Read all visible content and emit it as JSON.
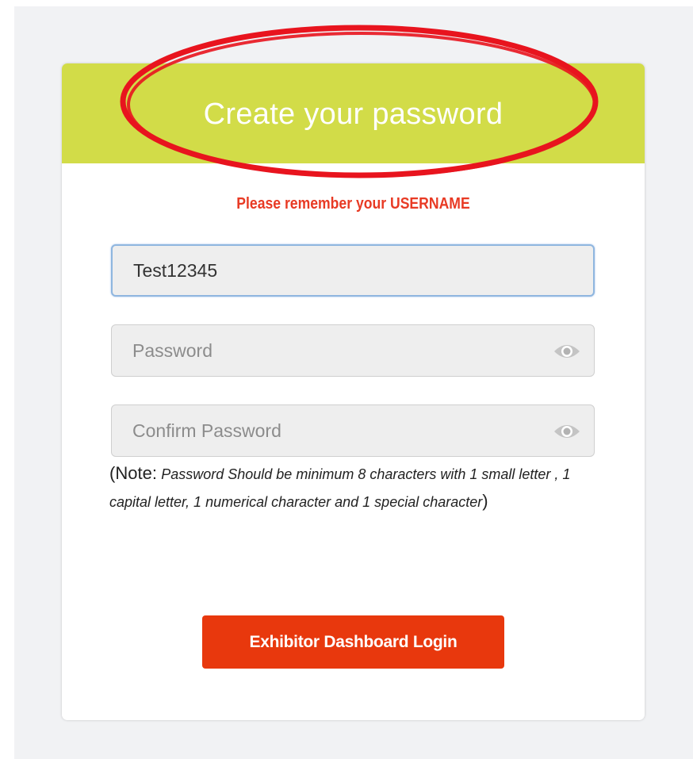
{
  "header": {
    "title": "Create your password",
    "color": "#d2dc48"
  },
  "notice": {
    "text": "Please remember your USERNAME",
    "color": "#e83a24"
  },
  "form": {
    "username": {
      "value": "Test12345"
    },
    "password": {
      "placeholder": "Password",
      "toggle_icon": "eye-icon"
    },
    "confirm_password": {
      "placeholder": "Confirm Password",
      "toggle_icon": "eye-icon"
    },
    "note": {
      "open": "(",
      "label": "Note",
      "colon": ":",
      "text": "Password Should be minimum 8 characters with 1 small letter , 1 capital letter, 1 numerical character and 1 special character",
      "close": ")"
    }
  },
  "actions": {
    "login_label": "Exhibitor Dashboard Login",
    "login_color": "#e8380d"
  },
  "annotation": {
    "color": "#e8141e"
  }
}
